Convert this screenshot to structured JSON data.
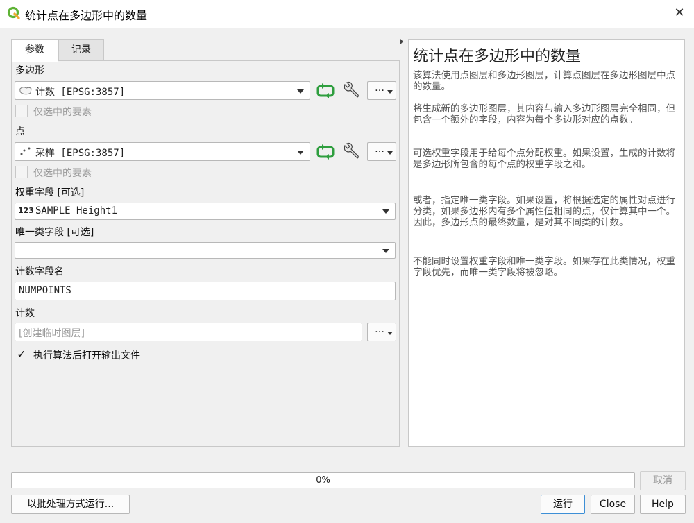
{
  "window": {
    "title": "统计点在多边形中的数量",
    "close_glyph": "✕"
  },
  "tabs": [
    {
      "label": "参数",
      "active": true
    },
    {
      "label": "记录",
      "active": false
    }
  ],
  "params": {
    "polygon": {
      "label": "多边形",
      "value": "计数 [EPSG:3857]",
      "icon": "polygon-layer-icon",
      "selected_only_label": "仅选中的要素",
      "selected_only_checked": false
    },
    "points": {
      "label": "点",
      "value": "采样 [EPSG:3857]",
      "icon": "point-layer-icon",
      "selected_only_label": "仅选中的要素",
      "selected_only_checked": false
    },
    "weight_field": {
      "label": "权重字段 [可选]",
      "type_badge": "123",
      "value": "SAMPLE_Height1"
    },
    "class_field": {
      "label": "唯一类字段 [可选]",
      "value": ""
    },
    "count_field_name": {
      "label": "计数字段名",
      "value": "NUMPOINTS"
    },
    "output": {
      "label": "计数",
      "placeholder": "[创建临时图层]",
      "value": ""
    },
    "open_output": {
      "label": "执行算法后打开输出文件",
      "checked": true
    },
    "more_button_label": "…"
  },
  "help": {
    "title": "统计点在多边形中的数量",
    "paragraphs": [
      "该算法使用点图层和多边形图层，计算点图层在多边形图层中点的数量。",
      "将生成新的多边形图层，其内容与输入多边形图层完全相同，但包含一个额外的字段，内容为每个多边形对应的点数。",
      "可选权重字段用于给每个点分配权重。如果设置，生成的计数将是多边形所包含的每个点的权重字段之和。",
      "或者，指定唯一类字段。如果设置，将根据选定的属性对点进行分类，如果多边形内有多个属性值相同的点，仅计算其中一个。因此，多边形点的最终数量，是对其不同类的计数。",
      "不能同时设置权重字段和唯一类字段。如果存在此类情况，权重字段优先，而唯一类字段将被忽略。"
    ]
  },
  "progress": {
    "value": 0,
    "text": "0%"
  },
  "buttons": {
    "cancel": "取消",
    "batch": "以批处理方式运行...",
    "run": "运行",
    "close": "Close",
    "help": "Help"
  },
  "colors": {
    "qgis_green": "#5fb336",
    "sync_green": "#2e9e3e",
    "progress_blue": "#3daee9"
  }
}
